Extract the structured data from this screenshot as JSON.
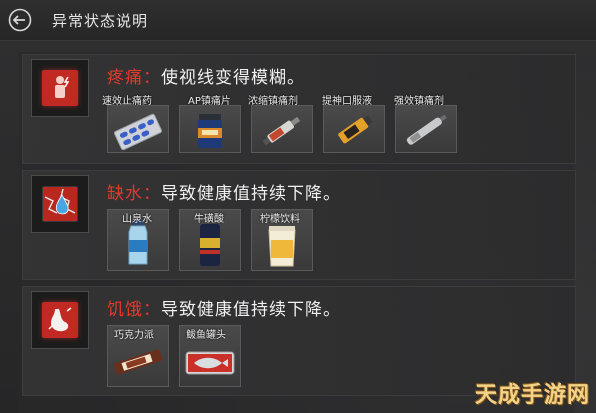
{
  "header": {
    "title": "异常状态说明"
  },
  "sections": [
    {
      "name": "疼痛",
      "colon": "：",
      "description": "使视线变得模糊。",
      "items": [
        {
          "label": "速效止痛药",
          "icon": "pill-blister-icon"
        },
        {
          "label": "AP镇痛片",
          "icon": "pill-jar-icon"
        },
        {
          "label": "浓缩镇痛剂",
          "icon": "syringe-icon"
        },
        {
          "label": "提神口服液",
          "icon": "vial-icon"
        },
        {
          "label": "强效镇痛剂",
          "icon": "injector-icon"
        }
      ]
    },
    {
      "name": "缺水",
      "colon": "：",
      "description": "导致健康值持续下降。",
      "items": [
        {
          "label": "山泉水",
          "icon": "water-bottle-icon"
        },
        {
          "label": "牛磺酸",
          "icon": "energy-can-icon"
        },
        {
          "label": "柠檬饮料",
          "icon": "lemon-drink-icon"
        }
      ]
    },
    {
      "name": "饥饿",
      "colon": "：",
      "description": "导致健康值持续下降。",
      "items": [
        {
          "label": "巧克力派",
          "icon": "chocolate-bar-icon"
        },
        {
          "label": "鲅鱼罐头",
          "icon": "fish-can-icon"
        }
      ]
    }
  ],
  "watermark": "天成手游网",
  "colors": {
    "accent_red": "#e23a2c",
    "icon_red": "#c12a22",
    "background": "#2a2a2b"
  }
}
